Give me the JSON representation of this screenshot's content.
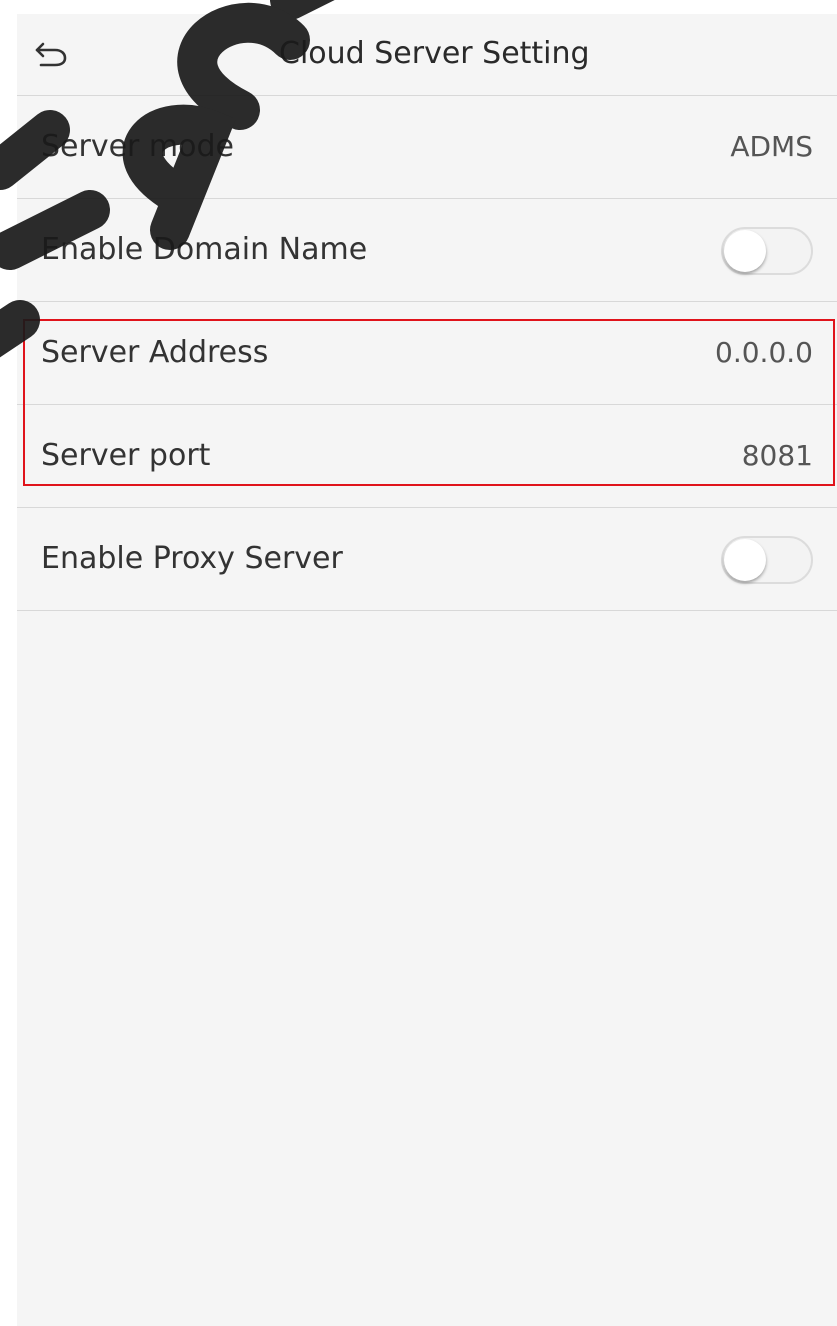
{
  "header": {
    "title": "Cloud Server Setting",
    "back_icon": "back-arrow-icon"
  },
  "rows": [
    {
      "label": "Server mode",
      "value": "ADMS"
    },
    {
      "label": "Enable Domain Name",
      "toggle": false
    },
    {
      "label": "Server Address",
      "value": "0.0.0.0"
    },
    {
      "label": "Server port",
      "value": "8081"
    },
    {
      "label": "Enable Proxy Server",
      "toggle": false
    }
  ],
  "colors": {
    "highlight": "#e0131b",
    "background": "#f5f5f5",
    "watermark": "#1a1a1a"
  }
}
